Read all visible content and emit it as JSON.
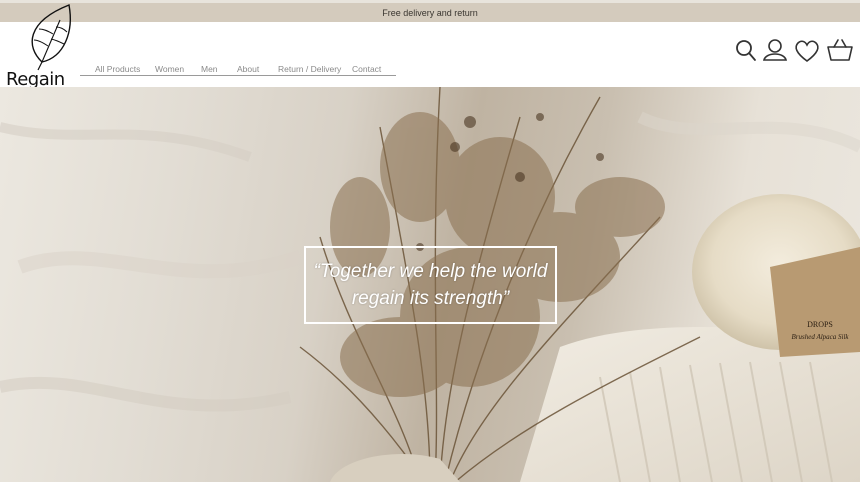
{
  "promo": {
    "text": "Free delivery and return"
  },
  "brand": {
    "name": "Regain"
  },
  "nav": {
    "items": [
      {
        "label": "All Products"
      },
      {
        "label": "Women"
      },
      {
        "label": "Men"
      },
      {
        "label": "About"
      },
      {
        "label": "Return / Delivery"
      },
      {
        "label": "Contact"
      }
    ]
  },
  "header_icons": [
    "search-icon",
    "account-icon",
    "wishlist-heart-icon",
    "cart-basket-icon"
  ],
  "hero": {
    "quote": "“Together we help the world regain its strength”",
    "yarn_label_brand": "DROPS",
    "yarn_label_product": "Brushed Alpaca Silk"
  },
  "colors": {
    "promo_bar": "#d4cbbd",
    "quote_text": "#ffffff",
    "nav_text": "#8a8a8a"
  }
}
